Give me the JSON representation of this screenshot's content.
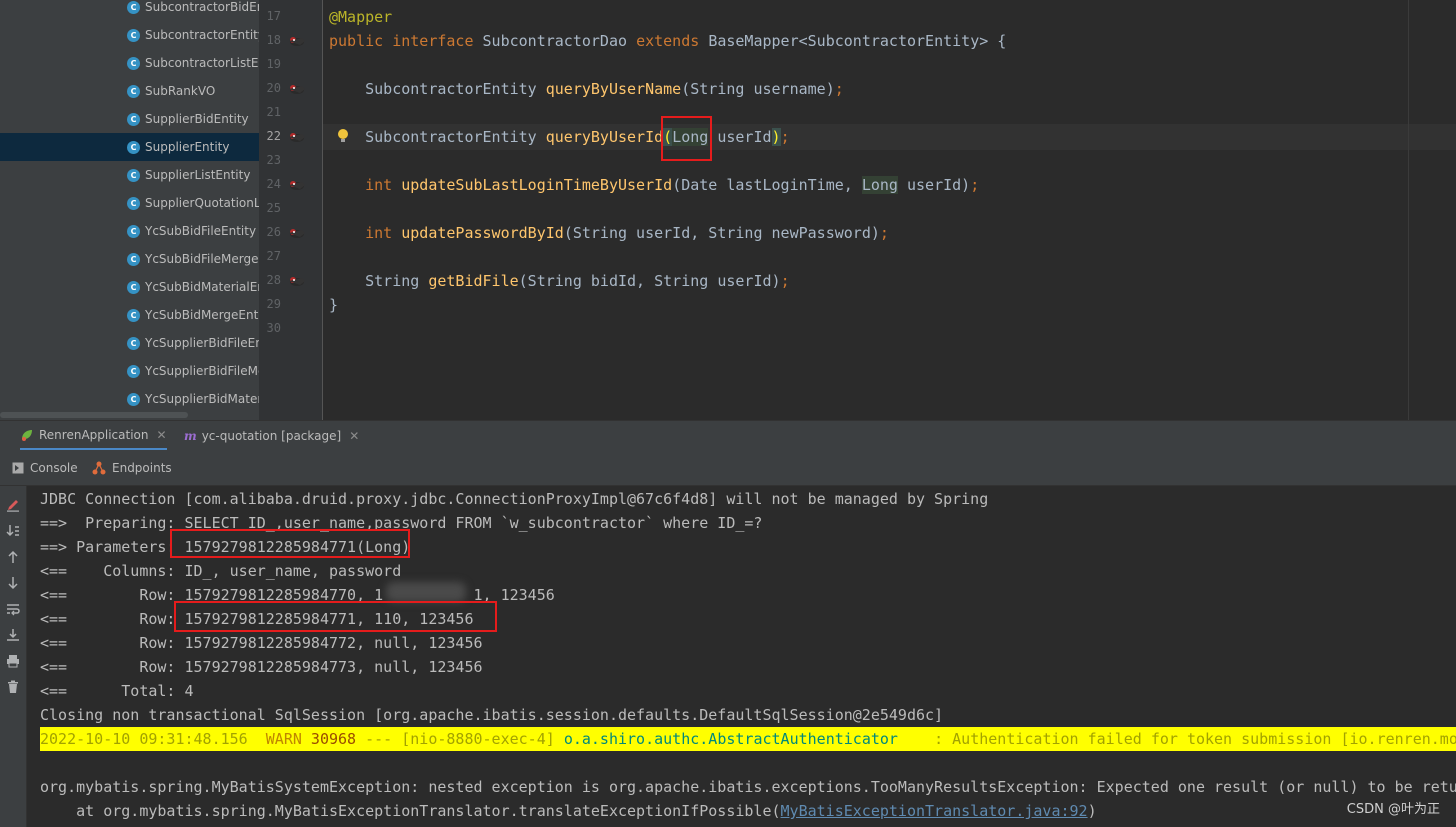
{
  "project_tree": {
    "items": [
      "SubcontractorBidEn",
      "SubcontractorEntity",
      "SubcontractorListEn",
      "SubRankVO",
      "SupplierBidEntity",
      "SupplierEntity",
      "SupplierListEntity",
      "SupplierQuotationLi",
      "YcSubBidFileEntity",
      "YcSubBidFileMergeE",
      "YcSubBidMaterialEn",
      "YcSubBidMergeEnti",
      "YcSupplierBidFileEnt",
      "YcSupplierBidFileMe",
      "YcSupplierBidMater"
    ],
    "selected": "SupplierEntity",
    "class_icon_glyph": "C"
  },
  "editor": {
    "line_numbers": [
      "17",
      "18",
      "19",
      "20",
      "21",
      "22",
      "23",
      "24",
      "25",
      "26",
      "27",
      "28",
      "29",
      "30"
    ],
    "active_line": "22",
    "lines": {
      "l17_annotation": "@Mapper",
      "l18_public": "public",
      "l18_interface": "interface",
      "l18_name": "SubcontractorDao",
      "l18_extends": "extends",
      "l18_rest": "BaseMapper<SubcontractorEntity> {",
      "l20_type": "SubcontractorEntity",
      "l20_method": "queryByUserName",
      "l20_params": "(String username)",
      "l20_end": ";",
      "l22_type": "SubcontractorEntity",
      "l22_method": "queryByUserId",
      "l22_open": "(",
      "l22_param_type": "Long",
      "l22_param_name": " userId",
      "l22_close": ")",
      "l22_end": ";",
      "l24_kw": "int",
      "l24_method": "updateSubLastLoginTimeByUserId",
      "l24_params_a": "(Date lastLoginTime, ",
      "l24_param_type": "Long",
      "l24_params_b": " userId)",
      "l24_end": ";",
      "l26_kw": "int",
      "l26_method": "updatePasswordById",
      "l26_params": "(String userId, String newPassword)",
      "l26_end": ";",
      "l28_type": "String",
      "l28_method": "getBidFile",
      "l28_params": "(String bidId, String userId)",
      "l28_end": ";",
      "l29_close": "}"
    }
  },
  "run_panel": {
    "tabs": [
      {
        "label": "RenrenApplication",
        "icon": "spring-boot-icon",
        "active": true
      },
      {
        "label": "yc-quotation [package]",
        "icon": "maven-icon",
        "active": false
      }
    ],
    "sub_tabs": [
      {
        "label": "Console",
        "icon": "console-icon"
      },
      {
        "label": "Endpoints",
        "icon": "endpoints-icon"
      }
    ],
    "toolbar_icons": [
      "edit-icon",
      "scroll-to-end-icon",
      "up-arrow-icon",
      "down-arrow-icon",
      "soft-wrap-icon",
      "sort-down-icon",
      "print-icon",
      "trash-icon"
    ]
  },
  "console": {
    "lines": [
      "JDBC Connection [com.alibaba.druid.proxy.jdbc.ConnectionProxyImpl@67c6f4d8] will not be managed by Spring",
      "==>  Preparing: SELECT ID_,user_name,password FROM `w_subcontractor` where ID_=?",
      "==> Parameters: 1579279812285984771(Long)",
      "<==    Columns: ID_, user_name, password",
      "<==        Row: 1579279812285984770, 1          1, 123456",
      "<==        Row: 1579279812285984771, 110, 123456",
      "<==        Row: 1579279812285984772, null, 123456",
      "<==        Row: 1579279812285984773, null, 123456",
      "<==      Total: 4",
      "Closing non transactional SqlSession [org.apache.ibatis.session.defaults.DefaultSqlSession@2e549d6c]"
    ],
    "warn_line": {
      "timestamp": "2022-10-10 09:31:48.156  ",
      "level": "WARN",
      "pid": " 30968",
      "thread": " --- [nio-8880-exec-4] ",
      "logger": "o.a.shiro.authc.AbstractAuthenticator",
      "message": "    : Authentication failed for token submission [io.renren.mod"
    },
    "exception_line": "org.mybatis.spring.MyBatisSystemException: nested exception is org.apache.ibatis.exceptions.TooManyResultsException: Expected one result (or null) to be retur",
    "stack_prefix": "    at org.mybatis.spring.MyBatisExceptionTranslator.translateExceptionIfPossible(",
    "stack_link": "MyBatisExceptionTranslator.java:92",
    "stack_suffix": ")"
  },
  "watermark": "CSDN @叶为正",
  "colors": {
    "highlight_box": "#e51c1c",
    "warn_background": "#ffff00",
    "keyword": "#cc7832",
    "method": "#ffc66d"
  }
}
